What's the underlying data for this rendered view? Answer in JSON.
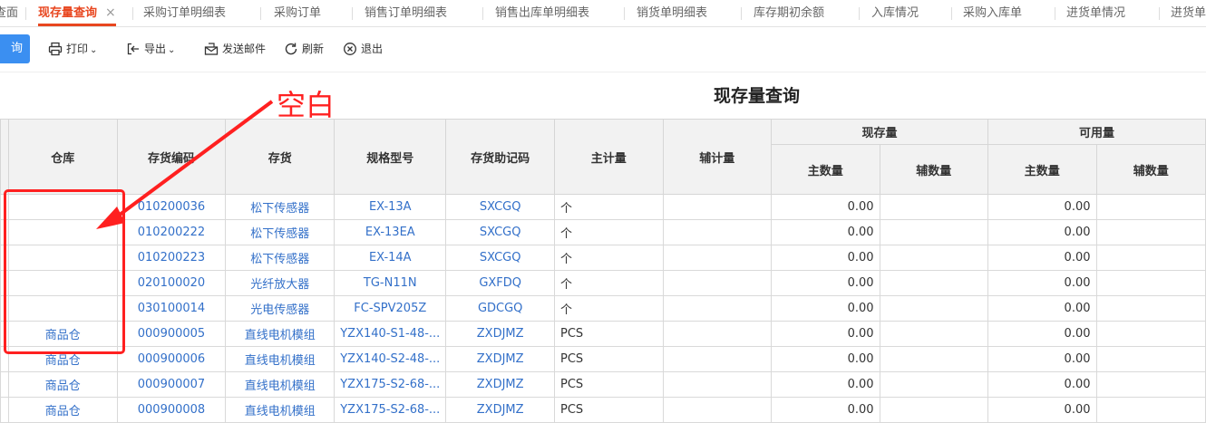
{
  "tabs": [
    {
      "label": "查面"
    },
    {
      "label": "现存量查询",
      "active": true
    },
    {
      "label": "采购订单明细表"
    },
    {
      "label": "采购订单"
    },
    {
      "label": "销售订单明细表"
    },
    {
      "label": "销售出库单明细表"
    },
    {
      "label": "销货单明细表"
    },
    {
      "label": "库存期初余额"
    },
    {
      "label": "入库情况"
    },
    {
      "label": "采购入库单"
    },
    {
      "label": "进货单情况"
    },
    {
      "label": "进货单"
    }
  ],
  "tab_close": "×",
  "toolbar": {
    "query_label": "询",
    "print_label": "打印",
    "export_label": "导出",
    "email_label": "发送邮件",
    "refresh_label": "刷新",
    "exit_label": "退出",
    "caret": "⌄"
  },
  "report_title": "现存量查询",
  "annotation_text": "空白",
  "table": {
    "headers": {
      "warehouse": "仓库",
      "code": "存货编码",
      "item": "存货",
      "spec": "规格型号",
      "mnemonic": "存货助记码",
      "main_unit": "主计量",
      "aux_unit": "辅计量",
      "onhand": "现存量",
      "available": "可用量",
      "main_qty": "主数量",
      "aux_qty": "辅数量"
    },
    "rows": [
      {
        "warehouse": "",
        "code": "010200036",
        "item": "松下传感器",
        "spec": "EX-13A",
        "mnemonic": "SXCGQ",
        "unit": "个",
        "aux": "",
        "onhand_main": "0.00",
        "onhand_aux": "",
        "avail_main": "0.00",
        "avail_aux": ""
      },
      {
        "warehouse": "",
        "code": "010200222",
        "item": "松下传感器",
        "spec": "EX-13EA",
        "mnemonic": "SXCGQ",
        "unit": "个",
        "aux": "",
        "onhand_main": "0.00",
        "onhand_aux": "",
        "avail_main": "0.00",
        "avail_aux": ""
      },
      {
        "warehouse": "",
        "code": "010200223",
        "item": "松下传感器",
        "spec": "EX-14A",
        "mnemonic": "SXCGQ",
        "unit": "个",
        "aux": "",
        "onhand_main": "0.00",
        "onhand_aux": "",
        "avail_main": "0.00",
        "avail_aux": ""
      },
      {
        "warehouse": "",
        "code": "020100020",
        "item": "光纤放大器",
        "spec": "TG-N11N",
        "mnemonic": "GXFDQ",
        "unit": "个",
        "aux": "",
        "onhand_main": "0.00",
        "onhand_aux": "",
        "avail_main": "0.00",
        "avail_aux": ""
      },
      {
        "warehouse": "",
        "code": "030100014",
        "item": "光电传感器",
        "spec": "FC-SPV205Z",
        "mnemonic": "GDCGQ",
        "unit": "个",
        "aux": "",
        "onhand_main": "0.00",
        "onhand_aux": "",
        "avail_main": "0.00",
        "avail_aux": ""
      },
      {
        "warehouse": "商品仓",
        "code": "000900005",
        "item": "直线电机模组",
        "spec": "YZX140-S1-48-...",
        "mnemonic": "ZXDJMZ",
        "unit": "PCS",
        "aux": "",
        "onhand_main": "0.00",
        "onhand_aux": "",
        "avail_main": "0.00",
        "avail_aux": ""
      },
      {
        "warehouse": "商品仓",
        "code": "000900006",
        "item": "直线电机模组",
        "spec": "YZX140-S2-48-...",
        "mnemonic": "ZXDJMZ",
        "unit": "PCS",
        "aux": "",
        "onhand_main": "0.00",
        "onhand_aux": "",
        "avail_main": "0.00",
        "avail_aux": ""
      },
      {
        "warehouse": "商品仓",
        "code": "000900007",
        "item": "直线电机模组",
        "spec": "YZX175-S2-68-...",
        "mnemonic": "ZXDJMZ",
        "unit": "PCS",
        "aux": "",
        "onhand_main": "0.00",
        "onhand_aux": "",
        "avail_main": "0.00",
        "avail_aux": ""
      },
      {
        "warehouse": "商品仓",
        "code": "000900008",
        "item": "直线电机模组",
        "spec": "YZX175-S2-68-...",
        "mnemonic": "ZXDJMZ",
        "unit": "PCS",
        "aux": "",
        "onhand_main": "0.00",
        "onhand_aux": "",
        "avail_main": "0.00",
        "avail_aux": ""
      }
    ]
  },
  "colors": {
    "accent": "#e8461f",
    "primary": "#3b8ff1",
    "link": "#3370c9",
    "annotation": "#ff2020"
  }
}
